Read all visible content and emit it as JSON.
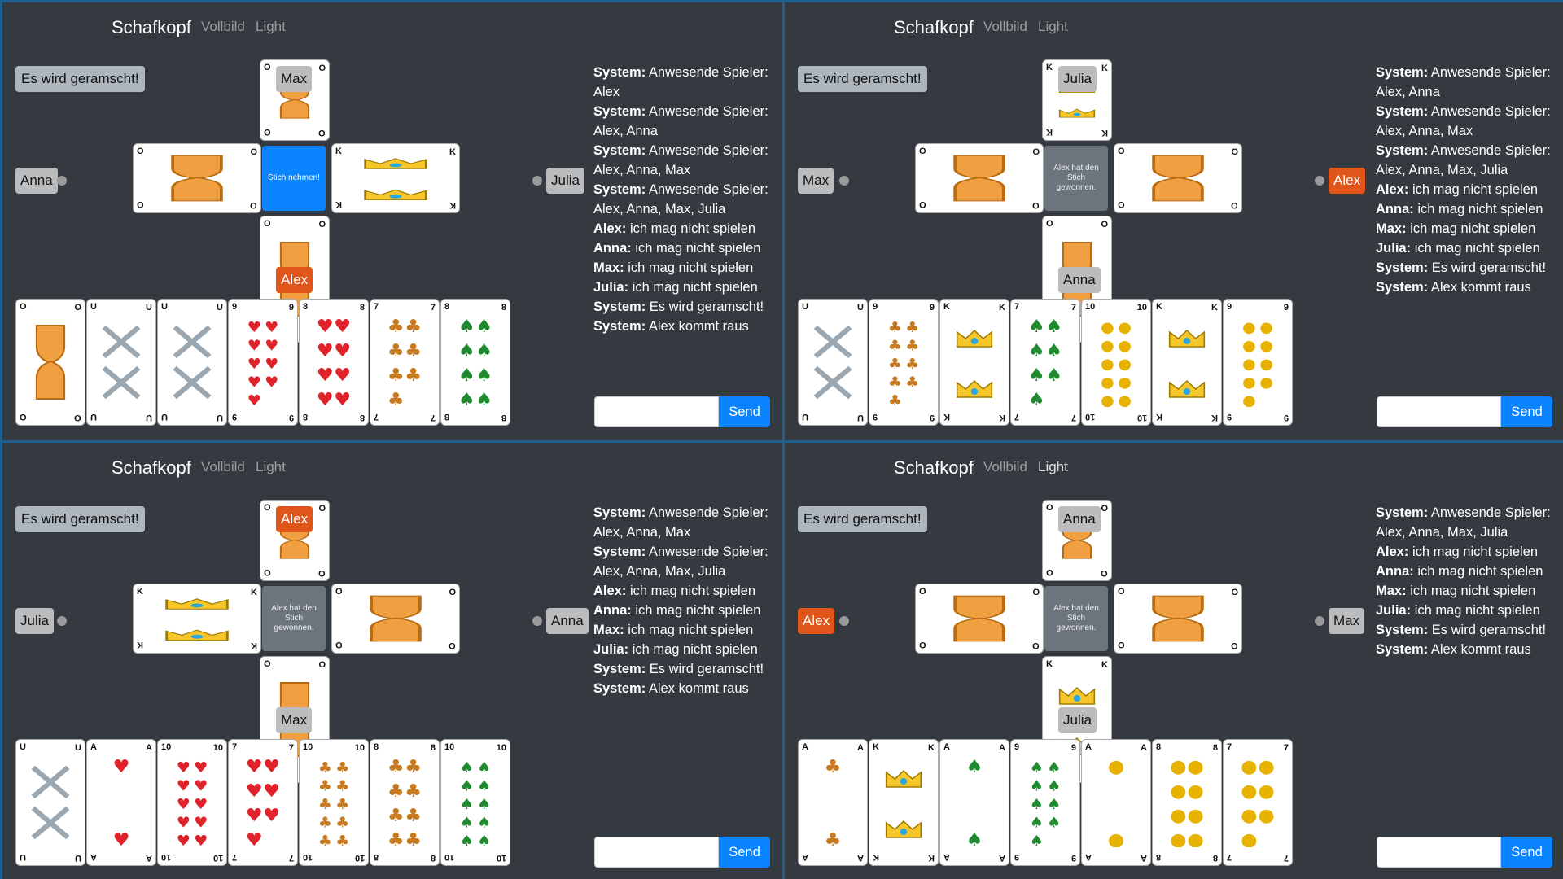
{
  "panes": [
    {
      "brand": "Schafkopf",
      "nav": [
        "Vollbild",
        "Light"
      ],
      "nav_active": -1,
      "status": "Es wird geramscht!",
      "top": "Max",
      "left": "Anna",
      "right": "Julia",
      "bottom": "Alex",
      "active": "bottom",
      "trick_text": "Stich nehmen!",
      "trick_kind": "primary",
      "trick_cards": {
        "top": {
          "rank": "O",
          "suit": "Schellen"
        },
        "left": {
          "rank": "O",
          "suit": "Herz"
        },
        "right": {
          "rank": "K",
          "suit": "Herz"
        },
        "bottom": {
          "rank": "O",
          "suit": "Schellen"
        }
      },
      "hand": [
        {
          "rank": "O",
          "suit": "Gras"
        },
        {
          "rank": "U",
          "suit": "Schellen"
        },
        {
          "rank": "U",
          "suit": "Eichel"
        },
        {
          "rank": "9",
          "suit": "Herz"
        },
        {
          "rank": "8",
          "suit": "Herz"
        },
        {
          "rank": "7",
          "suit": "Eichel"
        },
        {
          "rank": "8",
          "suit": "Gras"
        }
      ],
      "chat": [
        [
          "System:",
          "Anwesende Spieler: Alex"
        ],
        [
          "System:",
          "Anwesende Spieler: Alex, Anna"
        ],
        [
          "System:",
          "Anwesende Spieler: Alex, Anna, Max"
        ],
        [
          "System:",
          "Anwesende Spieler: Alex, Anna, Max, Julia"
        ],
        [
          "Alex:",
          "ich mag nicht spielen"
        ],
        [
          "Anna:",
          "ich mag nicht spielen"
        ],
        [
          "Max:",
          "ich mag nicht spielen"
        ],
        [
          "Julia:",
          "ich mag nicht spielen"
        ],
        [
          "System:",
          "Es wird geramscht!"
        ],
        [
          "System:",
          "Alex kommt raus"
        ]
      ],
      "send": "Send"
    },
    {
      "brand": "Schafkopf",
      "nav": [
        "Vollbild",
        "Light"
      ],
      "nav_active": -1,
      "status": "Es wird geramscht!",
      "top": "Julia",
      "left": "Max",
      "right": "Alex",
      "bottom": "Anna",
      "active": "right",
      "trick_text": "Alex hat den Stich gewonnen.",
      "trick_kind": "done",
      "trick_cards": {
        "top": {
          "rank": "K",
          "suit": "Herz"
        },
        "left": {
          "rank": "O",
          "suit": "Schellen"
        },
        "right": {
          "rank": "O",
          "suit": "Schellen"
        },
        "bottom": {
          "rank": "O",
          "suit": "Herz"
        }
      },
      "hand": [
        {
          "rank": "U",
          "suit": "Herz"
        },
        {
          "rank": "9",
          "suit": "Eichel"
        },
        {
          "rank": "K",
          "suit": "Gras"
        },
        {
          "rank": "7",
          "suit": "Gras"
        },
        {
          "rank": "10",
          "suit": "Schellen"
        },
        {
          "rank": "K",
          "suit": "Schellen"
        },
        {
          "rank": "9",
          "suit": "Schellen"
        }
      ],
      "chat": [
        [
          "System:",
          "Anwesende Spieler: Alex, Anna"
        ],
        [
          "System:",
          "Anwesende Spieler: Alex, Anna, Max"
        ],
        [
          "System:",
          "Anwesende Spieler: Alex, Anna, Max, Julia"
        ],
        [
          "Alex:",
          "ich mag nicht spielen"
        ],
        [
          "Anna:",
          "ich mag nicht spielen"
        ],
        [
          "Max:",
          "ich mag nicht spielen"
        ],
        [
          "Julia:",
          "ich mag nicht spielen"
        ],
        [
          "System:",
          "Es wird geramscht!"
        ],
        [
          "System:",
          "Alex kommt raus"
        ]
      ],
      "send": "Send"
    },
    {
      "brand": "Schafkopf",
      "nav": [
        "Vollbild",
        "Light"
      ],
      "nav_active": -1,
      "status": "Es wird geramscht!",
      "top": "Alex",
      "left": "Julia",
      "right": "Anna",
      "bottom": "Max",
      "active": "top",
      "trick_text": "Alex hat den Stich gewonnen.",
      "trick_kind": "done",
      "trick_cards": {
        "top": {
          "rank": "O",
          "suit": "Eichel"
        },
        "left": {
          "rank": "K",
          "suit": "Herz"
        },
        "right": {
          "rank": "O",
          "suit": "Herz"
        },
        "bottom": {
          "rank": "O",
          "suit": "Schellen"
        }
      },
      "hand": [
        {
          "rank": "U",
          "suit": "Gras"
        },
        {
          "rank": "A",
          "suit": "Herz"
        },
        {
          "rank": "10",
          "suit": "Herz"
        },
        {
          "rank": "7",
          "suit": "Herz"
        },
        {
          "rank": "10",
          "suit": "Eichel"
        },
        {
          "rank": "8",
          "suit": "Eichel"
        },
        {
          "rank": "10",
          "suit": "Gras"
        }
      ],
      "chat": [
        [
          "System:",
          "Anwesende Spieler: Alex, Anna, Max"
        ],
        [
          "System:",
          "Anwesende Spieler: Alex, Anna, Max, Julia"
        ],
        [
          "Alex:",
          "ich mag nicht spielen"
        ],
        [
          "Anna:",
          "ich mag nicht spielen"
        ],
        [
          "Max:",
          "ich mag nicht spielen"
        ],
        [
          "Julia:",
          "ich mag nicht spielen"
        ],
        [
          "System:",
          "Es wird geramscht!"
        ],
        [
          "System:",
          "Alex kommt raus"
        ]
      ],
      "send": "Send"
    },
    {
      "brand": "Schafkopf",
      "nav": [
        "Vollbild",
        "Light"
      ],
      "nav_active": 1,
      "status": "Es wird geramscht!",
      "top": "Anna",
      "left": "Alex",
      "right": "Max",
      "bottom": "Julia",
      "active": "left",
      "trick_text": "Alex hat den Stich gewonnen.",
      "trick_kind": "done",
      "trick_cards": {
        "top": {
          "rank": "O",
          "suit": "Herz"
        },
        "left": {
          "rank": "O",
          "suit": "Schellen"
        },
        "right": {
          "rank": "O",
          "suit": "Schellen"
        },
        "bottom": {
          "rank": "K",
          "suit": "Herz"
        }
      },
      "hand": [
        {
          "rank": "A",
          "suit": "Eichel"
        },
        {
          "rank": "K",
          "suit": "Gras"
        },
        {
          "rank": "A",
          "suit": "Gras"
        },
        {
          "rank": "9",
          "suit": "Gras"
        },
        {
          "rank": "A",
          "suit": "Schellen"
        },
        {
          "rank": "8",
          "suit": "Schellen"
        },
        {
          "rank": "7",
          "suit": "Schellen"
        }
      ],
      "chat": [
        [
          "System:",
          "Anwesende Spieler: Alex, Anna, Max, Julia"
        ],
        [
          "Alex:",
          "ich mag nicht spielen"
        ],
        [
          "Anna:",
          "ich mag nicht spielen"
        ],
        [
          "Max:",
          "ich mag nicht spielen"
        ],
        [
          "Julia:",
          "ich mag nicht spielen"
        ],
        [
          "System:",
          "Es wird geramscht!"
        ],
        [
          "System:",
          "Alex kommt raus"
        ]
      ],
      "send": "Send"
    }
  ],
  "colors": {
    "bg": "#343a40",
    "active_player": "#e0551a",
    "primary": "#0a84ff",
    "done": "#6c757d",
    "border": "#1f5f8f"
  },
  "icons": {
    "Herz": "heart-icon",
    "Gras": "leaf-icon",
    "Schellen": "bell-icon",
    "Eichel": "acorn-icon"
  }
}
